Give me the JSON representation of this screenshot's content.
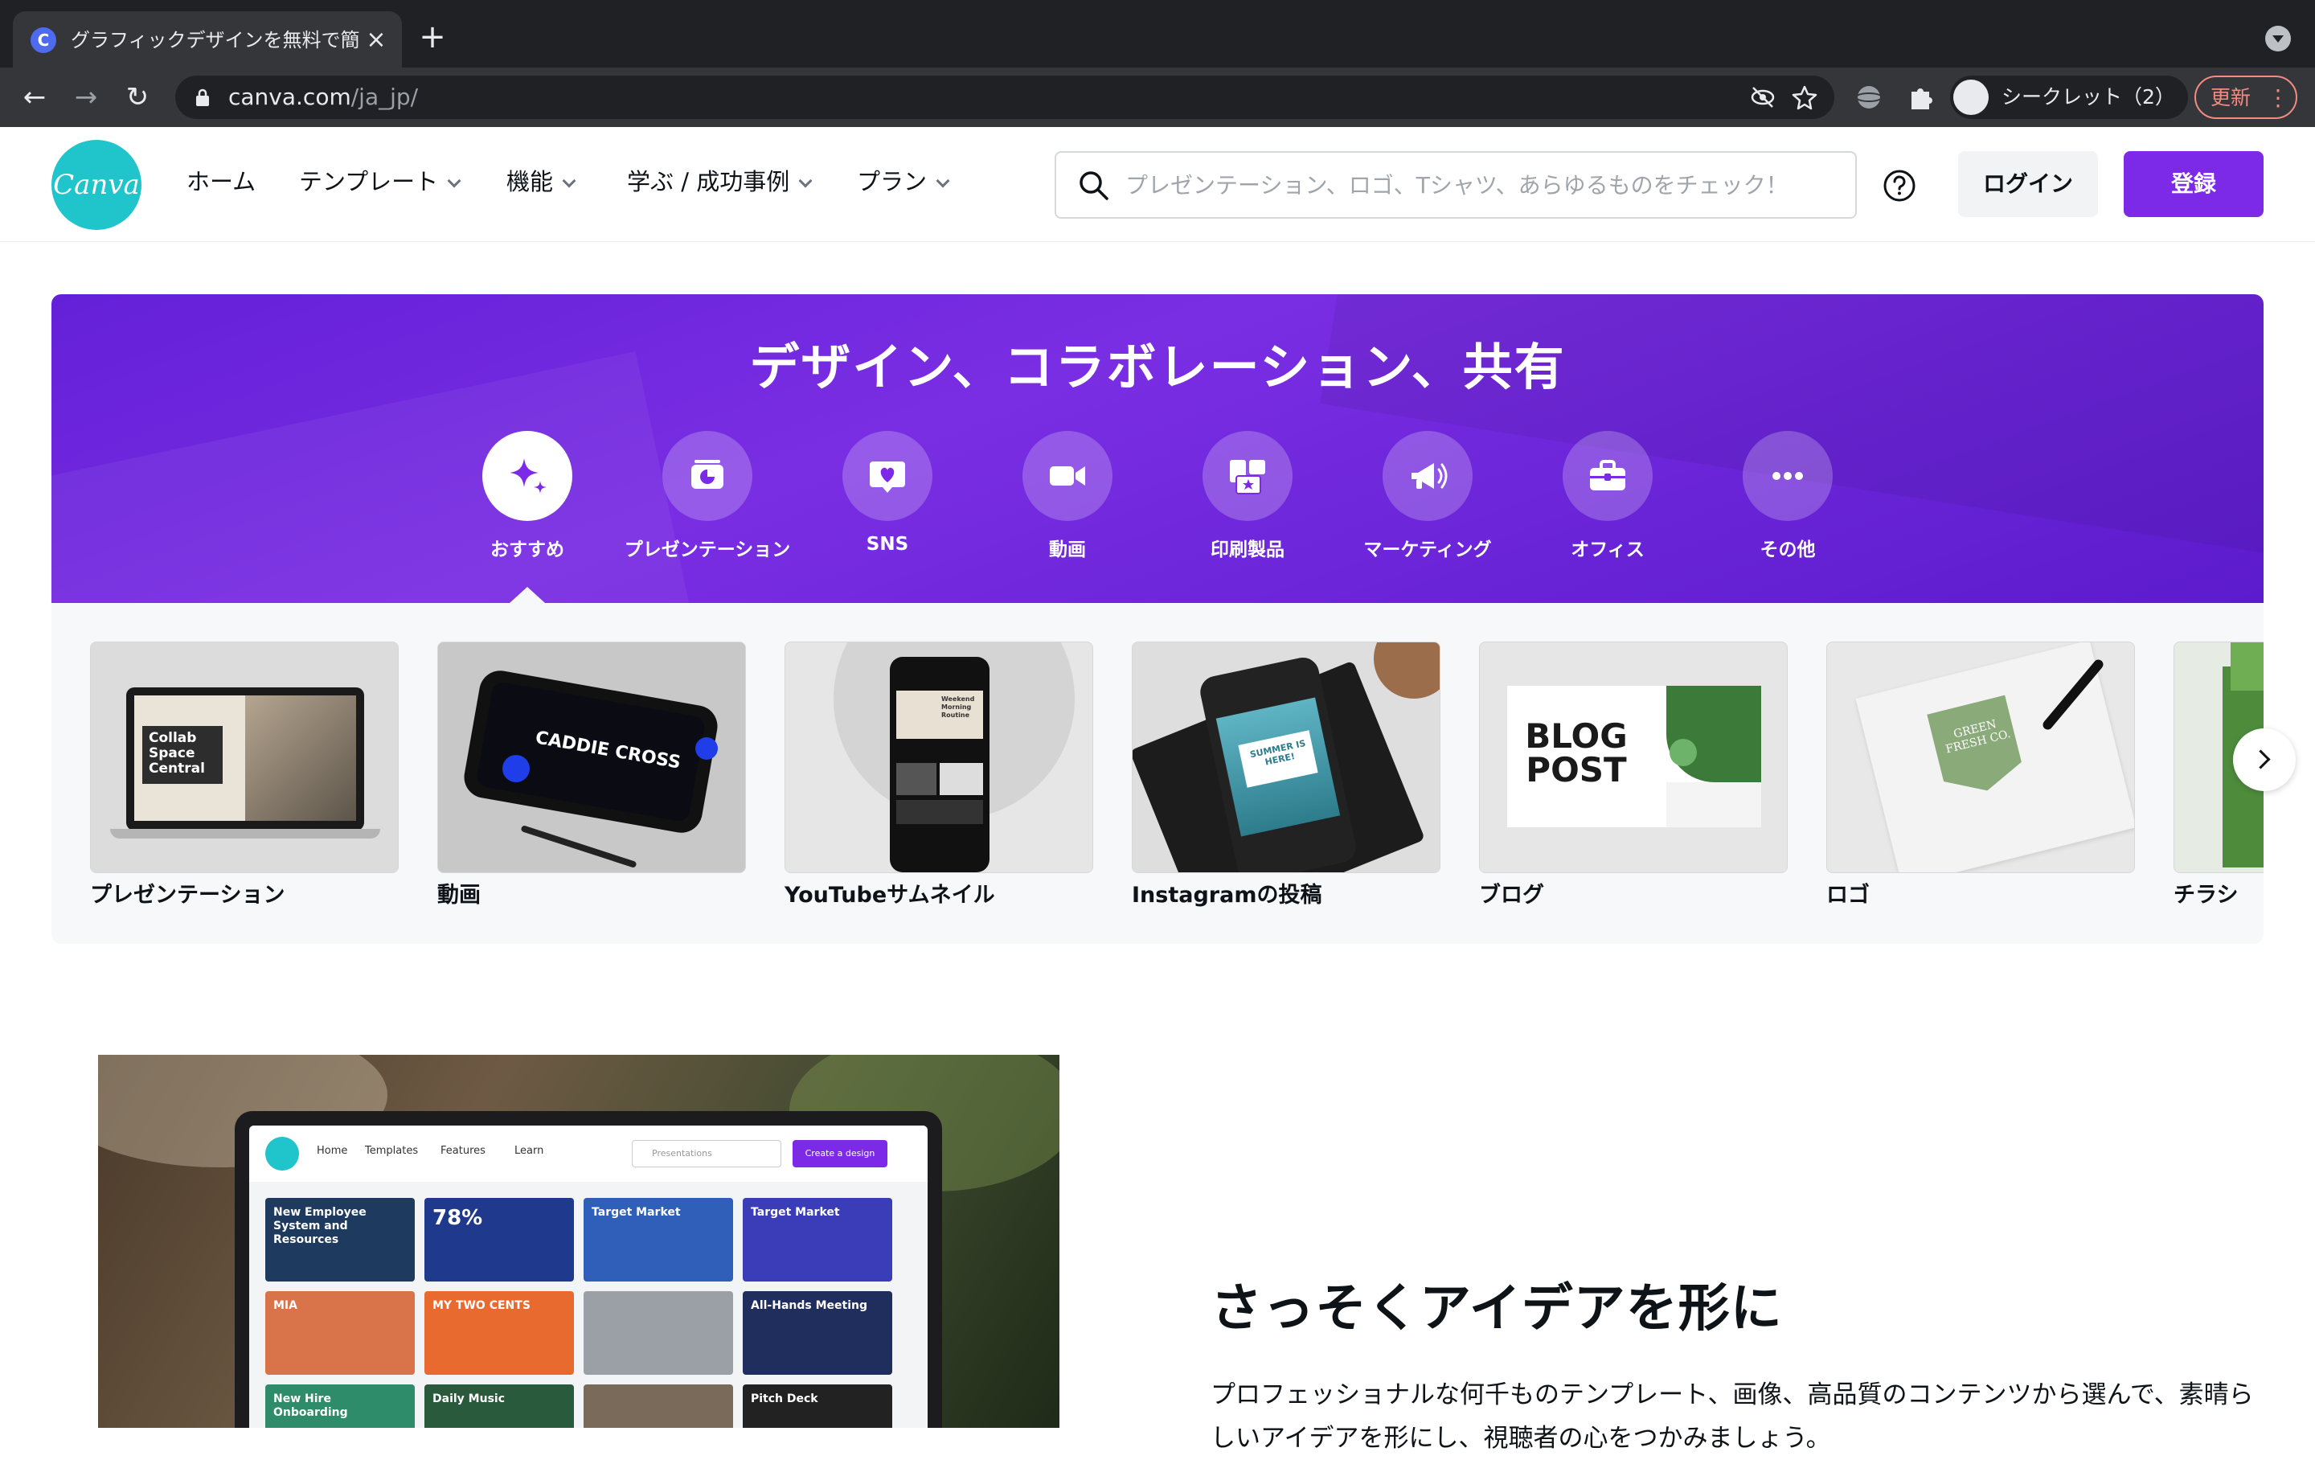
{
  "browser": {
    "tab_title": "グラフィックデザインを無料で簡単",
    "url_host": "canva.com",
    "url_path": "/ja_jp/",
    "incognito_label": "シークレット（2）",
    "update_label": "更新",
    "favicon_letter": "C"
  },
  "header": {
    "logo_text": "Canva",
    "menu": {
      "home": "ホーム",
      "templates": "テンプレート",
      "features": "機能",
      "learn": "学ぶ / 成功事例",
      "plans": "プラン"
    },
    "search_placeholder": "プレゼンテーション、ロゴ、Tシャツ、あらゆるものをチェック！",
    "login": "ログイン",
    "signup": "登録"
  },
  "hero": {
    "title": "デザイン、コラボレーション、共有",
    "categories": [
      {
        "label": "おすすめ",
        "icon": "sparkle-icon",
        "active": true
      },
      {
        "label": "プレゼンテーション",
        "icon": "presentation-icon"
      },
      {
        "label": "SNS",
        "icon": "heart-chat-icon"
      },
      {
        "label": "動画",
        "icon": "video-camera-icon"
      },
      {
        "label": "印刷製品",
        "icon": "print-icon"
      },
      {
        "label": "マーケティング",
        "icon": "megaphone-icon"
      },
      {
        "label": "オフィス",
        "icon": "briefcase-icon"
      },
      {
        "label": "その他",
        "icon": "more-dots-icon"
      }
    ],
    "accent": "#7d2ae8"
  },
  "templates": [
    {
      "label": "プレゼンテーション",
      "thumb_text": "Collab Space Central"
    },
    {
      "label": "動画",
      "thumb_text": "CADDIE CROSS"
    },
    {
      "label": "YouTubeサムネイル",
      "thumb_text": "Weekend Morning Routine"
    },
    {
      "label": "Instagramの投稿",
      "thumb_text": "SUMMER IS HERE!"
    },
    {
      "label": "ブログ",
      "thumb_text": "BLOG POST"
    },
    {
      "label": "ロゴ",
      "thumb_text": "GREEN FRESH CO."
    },
    {
      "label": "チラシ",
      "thumb_text": ""
    }
  ],
  "feature": {
    "mini_nav": [
      "Home",
      "Templates",
      "Features",
      "Learn"
    ],
    "mini_search": "Presentations",
    "mini_create": "Create a design",
    "mini_tiles": [
      "New Employee System and Resources",
      "78%",
      "Target Market",
      "Target Market",
      "MIA",
      "MY TWO CENTS",
      "",
      "All-Hands Meeting",
      "New Hire Onboarding",
      "Daily Music",
      "",
      "Pitch Deck"
    ],
    "title": "さっそくアイデアを形に",
    "body": "プロフェッショナルな何千ものテンプレート、画像、高品質のコンテンツから選んで、素晴らしいアイデアを形にし、視聴者の心をつかみましょう。"
  }
}
